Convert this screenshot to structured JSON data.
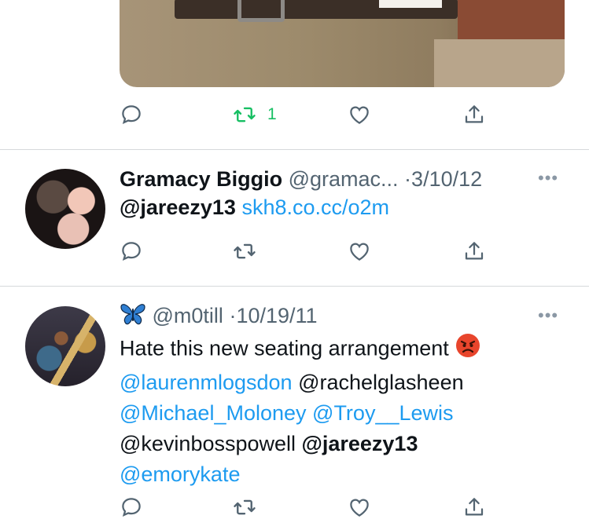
{
  "top_tweet": {
    "actions": {
      "reply_count": "",
      "retweet_count": "1",
      "like_count": ""
    }
  },
  "tweet1": {
    "name": "Gramacy Biggio",
    "handle": "@gramac...",
    "separator": "·",
    "date": "3/10/12",
    "more": "•••",
    "mention": "@jareezy13",
    "link": "skh8.co.cc/o2m"
  },
  "tweet2": {
    "name_emoji": "butterfly",
    "handle": "@m0till",
    "separator": "·",
    "date": "10/19/11",
    "more": "•••",
    "line1": "Hate this new seating arrangement",
    "line1_emoji": "angry-face",
    "mention_laurenm": "@laurenmlogsdon",
    "mention_rachel": "@rachelglasheen",
    "mention_michael": "@Michael_Moloney",
    "mention_troy": "@Troy__Lewis",
    "mention_kevin": "@kevinbosspowell",
    "mention_jareezy": "@jareezy13",
    "mention_emory": "@emorykate"
  },
  "colors": {
    "retweet_active": "#17bf63",
    "link": "#1d9bf0",
    "icon": "#536471",
    "divider": "#d6d9db"
  },
  "icons": [
    "reply-icon",
    "retweet-icon",
    "like-icon",
    "share-icon",
    "more-icon"
  ]
}
